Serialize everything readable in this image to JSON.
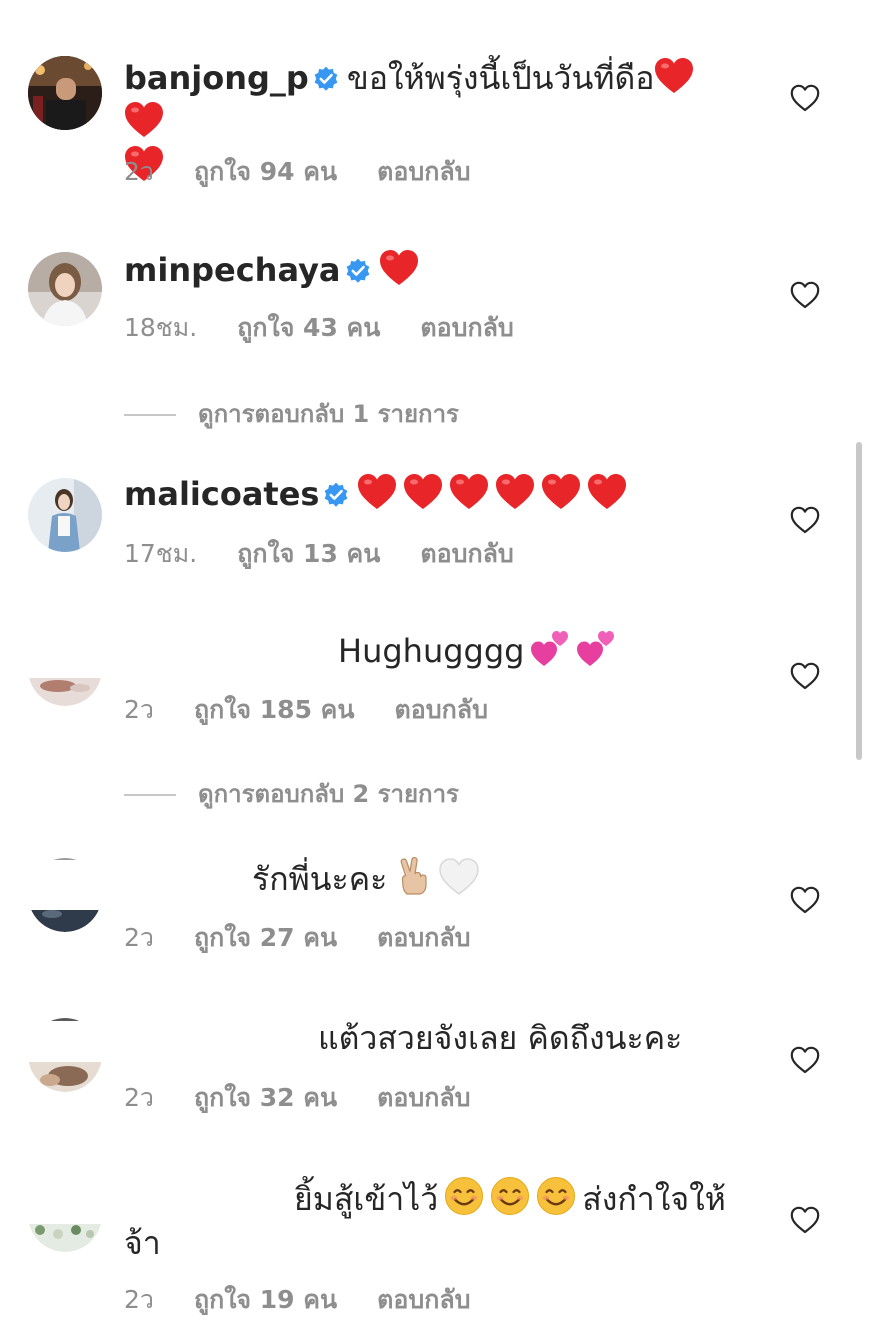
{
  "comments": [
    {
      "username": "banjong_p",
      "verified": true,
      "text": "ขอให้พรุ่งนี้เป็นวันที่ดือ",
      "emojis": [
        "red-heart",
        "red-heart",
        "red-heart"
      ],
      "time": "2ว",
      "likes": "ถูกใจ 94 คน",
      "reply": "ตอบกลับ"
    },
    {
      "username": "minpechaya",
      "verified": true,
      "text": "",
      "emojis": [
        "red-heart"
      ],
      "time": "18ชม.",
      "likes": "ถูกใจ 43 คน",
      "reply": "ตอบกลับ"
    },
    {
      "username": "malicoates",
      "verified": true,
      "text": "",
      "emojis": [
        "red-heart",
        "red-heart",
        "red-heart",
        "red-heart",
        "red-heart",
        "red-heart"
      ],
      "time": "17ชม.",
      "likes": "ถูกใจ 13 คน",
      "reply": "ตอบกลับ"
    },
    {
      "username": "",
      "text": "Hughugggg",
      "emojis": [
        "two-hearts",
        "two-hearts"
      ],
      "time": "2ว",
      "likes": "ถูกใจ 185 คน",
      "reply": "ตอบกลับ"
    },
    {
      "username": "",
      "text": "รักพี่นะคะ",
      "emojis": [
        "victory-hand",
        "white-heart"
      ],
      "time": "2ว",
      "likes": "ถูกใจ 27 คน",
      "reply": "ตอบกลับ"
    },
    {
      "username": "",
      "text": "แต้วสวยจังเลย คิดถึงนะคะ",
      "emojis": [],
      "time": "2ว",
      "likes": "ถูกใจ 32 คน",
      "reply": "ตอบกลับ"
    },
    {
      "username": "",
      "text_line1": "ยิ้มสู้เข้าไว้",
      "text_mid": "ส่งกำใจให้",
      "text_line2": "จ้า",
      "emojis": [
        "smiling-face",
        "smiling-face",
        "smiling-face"
      ],
      "time": "2ว",
      "likes": "ถูกใจ 19 คน",
      "reply": "ตอบกลับ"
    }
  ],
  "view_replies": [
    {
      "label": "ดูการตอบกลับ 1 รายการ"
    },
    {
      "label": "ดูการตอบกลับ 2 รายการ"
    }
  ],
  "colors": {
    "text": "#262626",
    "secondary": "#8e8e8e",
    "verified": "#3897f0",
    "heart": "#ed2a2a",
    "divider": "#c7c7c7"
  }
}
